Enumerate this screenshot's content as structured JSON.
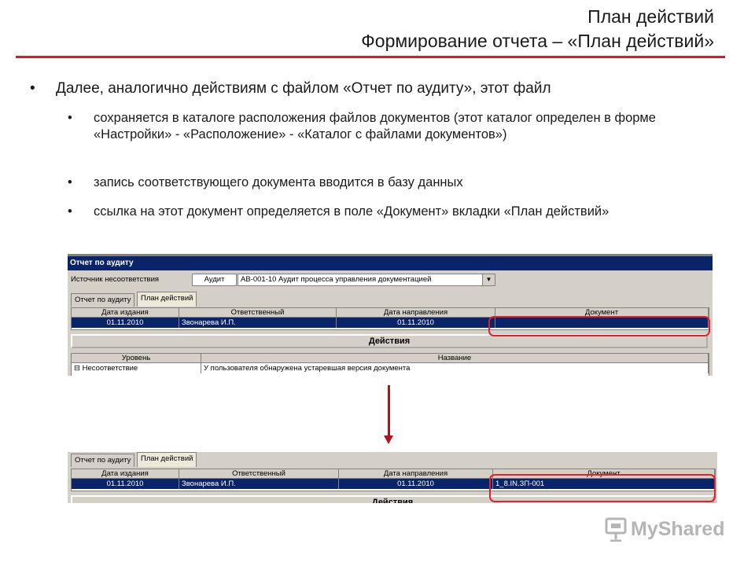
{
  "header": {
    "title": "План действий",
    "subtitle": "Формирование отчета – «План действий»"
  },
  "bullets": {
    "main": "Далее, аналогично действиям с файлом «Отчет по аудиту», этот файл",
    "sub": [
      "сохраняется в каталоге расположения файлов документов (этот каталог определен в форме «Настройки» - «Расположение» - «Каталог с файлами документов»)",
      "запись соответствующего документа вводится в базу данных",
      "ссылка на этот документ определяется в поле «Документ» вкладки «План действий»"
    ]
  },
  "screen1": {
    "window_title": "Отчет по аудиту",
    "source_label": "Источник несоответствия",
    "source_kind": "Аудит",
    "source_value": "АВ-001-10  Аудит процесса управления документацией",
    "tabs": [
      "Отчет по аудиту",
      "План действий"
    ],
    "columns": [
      "Дата издания",
      "Ответственный",
      "Дата направления",
      "Документ"
    ],
    "row": [
      "01.11.2010",
      "Звонарева И.П.",
      "01.11.2010",
      ""
    ],
    "actions_label": "Действия",
    "actions_columns": [
      "Уровень",
      "Название"
    ],
    "actions_row": [
      "Несоответствие",
      "У пользователя обнаружена устаревшая версия документа"
    ],
    "tree_toggle": "⊟"
  },
  "screen2": {
    "tabs": [
      "Отчет по аудиту",
      "План действий"
    ],
    "columns": [
      "Дата издания",
      "Ответственный",
      "Дата направления",
      "Документ"
    ],
    "row": [
      "01.11.2010",
      "Звонарева И.П.",
      "01.11.2010",
      "1_8.IN.ЗП-001"
    ],
    "actions_label": "Действия"
  },
  "logo": {
    "text": "MyShared",
    "icon": "presentation-board-icon"
  },
  "colors": {
    "accent_red": "#d21f26",
    "selection_blue": "#0a246a",
    "window_gray": "#d4d0c8"
  }
}
